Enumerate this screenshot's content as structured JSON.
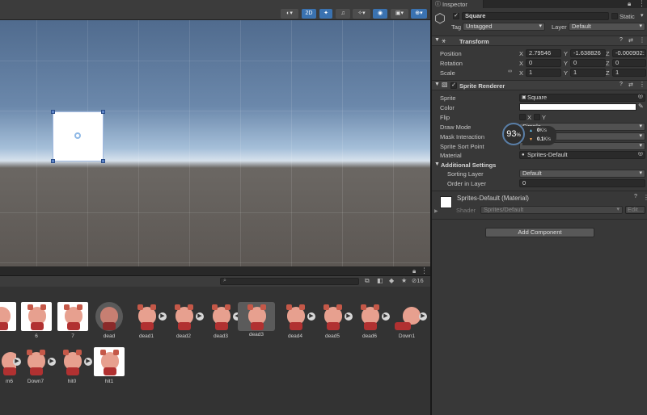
{
  "scene": {
    "toolbar": {
      "mode_2d": "2D"
    }
  },
  "project": {
    "search_placeholder": "",
    "item_count": "16",
    "row1": [
      {
        "name": ""
      },
      {
        "name": "6"
      },
      {
        "name": "7"
      },
      {
        "name": "dead"
      },
      {
        "name": "dead1"
      },
      {
        "name": "dead2"
      },
      {
        "name": "dead3"
      },
      {
        "name": "dead3"
      },
      {
        "name": "dead4"
      },
      {
        "name": "dead5"
      },
      {
        "name": "dead6"
      },
      {
        "name": "Down1"
      }
    ],
    "row2": [
      {
        "name": "m6"
      },
      {
        "name": "Down7"
      },
      {
        "name": "hit0"
      },
      {
        "name": "hit1"
      }
    ]
  },
  "inspector": {
    "tab_label": "Inspector",
    "object_name": "Square",
    "static_label": "Static",
    "tag_label": "Tag",
    "tag_value": "Untagged",
    "layer_label": "Layer",
    "layer_value": "Default",
    "transform": {
      "title": "Transform",
      "position_label": "Position",
      "rotation_label": "Rotation",
      "scale_label": "Scale",
      "position": {
        "x": "2.79546",
        "y": "-1.638826",
        "z": "-0.000902:"
      },
      "rotation": {
        "x": "0",
        "y": "0",
        "z": "0"
      },
      "scale": {
        "x": "1",
        "y": "1",
        "z": "1"
      },
      "x_axis": "X",
      "y_axis": "Y",
      "z_axis": "Z"
    },
    "sprite_renderer": {
      "title": "Sprite Renderer",
      "sprite_label": "Sprite",
      "sprite_value": "Square",
      "color_label": "Color",
      "flip_label": "Flip",
      "flip_x": "X",
      "flip_y": "Y",
      "draw_mode_label": "Draw Mode",
      "draw_mode_value": "Simple",
      "mask_interaction_label": "Mask Interaction",
      "sprite_sort_point_label": "Sprite Sort Point",
      "material_label": "Material",
      "material_value": "Sprites-Default",
      "additional_settings": "Additional Settings",
      "sorting_layer_label": "Sorting Layer",
      "sorting_layer_value": "Default",
      "order_in_layer_label": "Order in Layer",
      "order_in_layer_value": "0"
    },
    "material": {
      "title": "Sprites-Default (Material)",
      "shader_label": "Shader",
      "shader_value": "Sprites/Default",
      "edit_label": "Edit..."
    },
    "add_component": "Add Component"
  },
  "perf_overlay": {
    "percent": "93",
    "unit": "%",
    "upload": "0",
    "upload_unit": "K/s",
    "download": "0.1",
    "download_unit": "K/s"
  }
}
